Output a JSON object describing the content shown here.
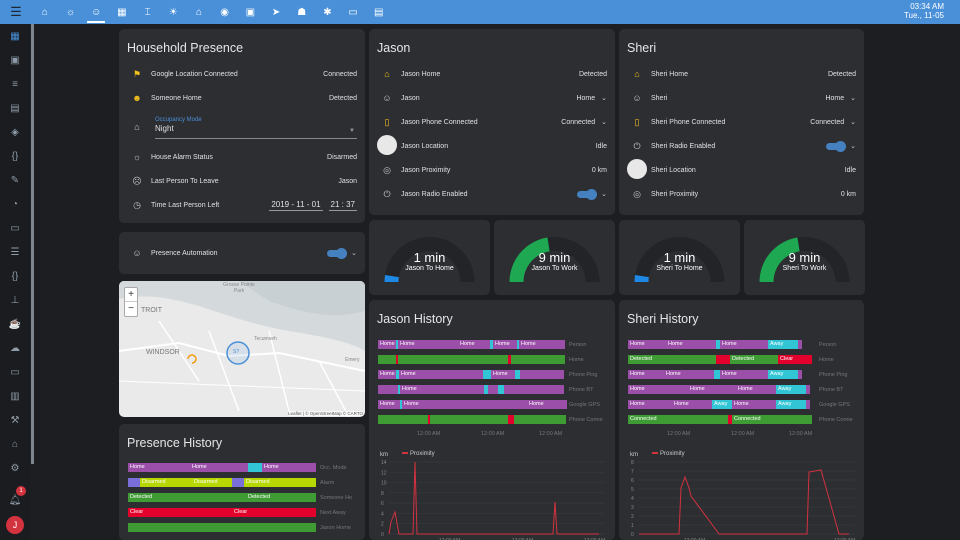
{
  "topbar": {
    "menu_icon": "menu-icon",
    "tabs": [
      {
        "icon": "home-icon",
        "active": false
      },
      {
        "icon": "lightbulb-icon",
        "active": false
      },
      {
        "icon": "people-icon",
        "active": true
      },
      {
        "icon": "calendar-icon",
        "active": false
      },
      {
        "icon": "thermometer-icon",
        "active": false
      },
      {
        "icon": "sun-icon",
        "active": false
      },
      {
        "icon": "garage-icon",
        "active": false
      },
      {
        "icon": "camera-icon",
        "active": false
      },
      {
        "icon": "gallery-icon",
        "active": false
      },
      {
        "icon": "send-icon",
        "active": false
      },
      {
        "icon": "robot-icon",
        "active": false
      },
      {
        "icon": "bug-icon",
        "active": false
      },
      {
        "icon": "monitor-icon",
        "active": false
      },
      {
        "icon": "server-icon",
        "active": false
      }
    ],
    "time": "03:34 AM",
    "date": "Tue., 11-05"
  },
  "sidebar": {
    "notification_count": "1",
    "avatar_letter": "J"
  },
  "household": {
    "title": "Household Presence",
    "rows": [
      {
        "label": "Google Location Connected",
        "value": "Connected"
      },
      {
        "label": "Someone Home",
        "value": "Detected"
      }
    ],
    "occupancy_label": "Occupancy Mode",
    "occupancy_value": "Night",
    "rows2": [
      {
        "label": "House Alarm Status",
        "value": "Disarmed"
      },
      {
        "label": "Last Person To Leave",
        "value": "Jason"
      }
    ],
    "time_left_label": "Time Last Person Left",
    "time_left_date": "2019 - 11 - 01",
    "time_left_time": "21 : 37"
  },
  "automation": {
    "label": "Presence Automation"
  },
  "map": {
    "zoom_in": "+",
    "zoom_out": "−",
    "labels": {
      "detroit": "TROIT",
      "windsor": "WINDSOR",
      "tecumseh": "Tecumseh",
      "emery": "Emery",
      "grosse": "Grosse Pointe Park"
    },
    "attribution": "Leaflet | © OpenStreetMap © CARTO",
    "marker": "S?"
  },
  "jason": {
    "title": "Jason",
    "rows": [
      {
        "label": "Jason Home",
        "value": "Detected"
      },
      {
        "label": "Jason",
        "value": "Home"
      },
      {
        "label": "Jason Phone Connected",
        "value": "Connected"
      },
      {
        "label": "Jason Location",
        "value": "Idle"
      },
      {
        "label": "Jason Proximity",
        "value": "0 km"
      },
      {
        "label": "Jason Radio Enabled",
        "value": ""
      }
    ]
  },
  "sheri": {
    "title": "Sheri",
    "rows": [
      {
        "label": "Sheri Home",
        "value": "Detected"
      },
      {
        "label": "Sheri",
        "value": "Home"
      },
      {
        "label": "Sheri Phone Connected",
        "value": "Connected"
      },
      {
        "label": "Sheri Radio Enabled",
        "value": ""
      },
      {
        "label": "Sheri Location",
        "value": "Idle"
      },
      {
        "label": "Sheri Proximity",
        "value": "0 km"
      }
    ]
  },
  "gauges": [
    {
      "value": "1 min",
      "name": "Jason To Home",
      "fraction": 0.05,
      "color": "#1e88e5"
    },
    {
      "value": "9 min",
      "name": "Jason To Work",
      "fraction": 0.45,
      "color": "#1da851"
    },
    {
      "value": "1 min",
      "name": "Sheri To Home",
      "fraction": 0.05,
      "color": "#1e88e5"
    },
    {
      "value": "9 min",
      "name": "Sheri To Work",
      "fraction": 0.45,
      "color": "#1da851"
    }
  ],
  "jason_history": {
    "title": "Jason History",
    "rows": [
      {
        "name": "Person",
        "segments": [
          {
            "label": "Home",
            "c": "#9b4fa8",
            "w": 18
          },
          {
            "label": "",
            "c": "#31c5d6",
            "w": 2
          },
          {
            "label": "Home",
            "c": "#9b4fa8",
            "w": 60
          },
          {
            "label": "Home",
            "c": "#9b4fa8",
            "w": 32
          },
          {
            "label": "",
            "c": "#31c5d6",
            "w": 3
          },
          {
            "label": "Home",
            "c": "#9b4fa8",
            "w": 24
          },
          {
            "label": "",
            "c": "#31c5d6",
            "w": 1
          },
          {
            "label": "Home",
            "c": "#9b4fa8",
            "w": 46
          }
        ]
      },
      {
        "name": "Home",
        "segments": [
          {
            "label": "",
            "c": "#3f9c35",
            "w": 18
          },
          {
            "label": "",
            "c": "#e3002d",
            "w": 2
          },
          {
            "label": "",
            "c": "#3f9c35",
            "w": 110
          },
          {
            "label": "",
            "c": "#e3002d",
            "w": 3
          },
          {
            "label": "",
            "c": "#3f9c35",
            "w": 54
          }
        ]
      },
      {
        "name": "Phone Ping",
        "segments": [
          {
            "label": "Home",
            "c": "#9b4fa8",
            "w": 18
          },
          {
            "label": "",
            "c": "#31c5d6",
            "w": 3
          },
          {
            "label": "Home",
            "c": "#9b4fa8",
            "w": 84
          },
          {
            "label": "",
            "c": "#31c5d6",
            "w": 8
          },
          {
            "label": "Home",
            "c": "#9b4fa8",
            "w": 24
          },
          {
            "label": "",
            "c": "#31c5d6",
            "w": 5
          },
          {
            "label": "",
            "c": "#9b4fa8",
            "w": 44
          }
        ]
      },
      {
        "name": "Phone BT",
        "segments": [
          {
            "label": "",
            "c": "#9b4fa8",
            "w": 20
          },
          {
            "label": "",
            "c": "#31c5d6",
            "w": 2
          },
          {
            "label": "Home",
            "c": "#9b4fa8",
            "w": 84
          },
          {
            "label": "",
            "c": "#31c5d6",
            "w": 4
          },
          {
            "label": "",
            "c": "#9b4fa8",
            "w": 10
          },
          {
            "label": "",
            "c": "#31c5d6",
            "w": 6
          },
          {
            "label": "",
            "c": "#9b4fa8",
            "w": 60
          }
        ]
      },
      {
        "name": "Google GPS",
        "segments": [
          {
            "label": "Home",
            "c": "#9b4fa8",
            "w": 22
          },
          {
            "label": "",
            "c": "#31c5d6",
            "w": 1
          },
          {
            "label": "Home",
            "c": "#9b4fa8",
            "w": 125
          },
          {
            "label": "Home",
            "c": "#9b4fa8",
            "w": 40
          }
        ]
      },
      {
        "name": "Phone Conne",
        "segments": [
          {
            "label": "",
            "c": "#3f9c35",
            "w": 50
          },
          {
            "label": "",
            "c": "#e3002d",
            "w": 2
          },
          {
            "label": "",
            "c": "#3f9c35",
            "w": 78
          },
          {
            "label": "",
            "c": "#e3002d",
            "w": 6
          },
          {
            "label": "",
            "c": "#3f9c35",
            "w": 52
          }
        ]
      }
    ],
    "axis": [
      "12:00 AM",
      "12:00 AM",
      "12:00 AM"
    ],
    "chart_unit": "km",
    "chart_legend": "Proximity",
    "chart_yticks": [
      "14",
      "12",
      "10",
      "8",
      "6",
      "4",
      "2",
      "0"
    ],
    "chart_xticks": [
      "12:00 AM",
      "12:00 AM",
      "12:00 AM"
    ]
  },
  "sheri_history": {
    "title": "Sheri History",
    "rows": [
      {
        "name": "Person",
        "segments": [
          {
            "label": "Home",
            "c": "#9b4fa8",
            "w": 38
          },
          {
            "label": "Home",
            "c": "#9b4fa8",
            "w": 50
          },
          {
            "label": "",
            "c": "#31c5d6",
            "w": 4
          },
          {
            "label": "Home",
            "c": "#9b4fa8",
            "w": 48
          },
          {
            "label": "Away",
            "c": "#31c5d6",
            "w": 30
          },
          {
            "label": "",
            "c": "#9b4fa8",
            "w": 4
          }
        ]
      },
      {
        "name": "Home",
        "segments": [
          {
            "label": "Detected",
            "c": "#3f9c35",
            "w": 88
          },
          {
            "label": "",
            "c": "#e3002d",
            "w": 14
          },
          {
            "label": "Detected",
            "c": "#3f9c35",
            "w": 48
          },
          {
            "label": "Clear",
            "c": "#e3002d",
            "w": 34
          }
        ]
      },
      {
        "name": "Phone Ping",
        "segments": [
          {
            "label": "Home",
            "c": "#9b4fa8",
            "w": 36
          },
          {
            "label": "Home",
            "c": "#9b4fa8",
            "w": 50
          },
          {
            "label": "",
            "c": "#31c5d6",
            "w": 6
          },
          {
            "label": "Home",
            "c": "#9b4fa8",
            "w": 48
          },
          {
            "label": "Away",
            "c": "#31c5d6",
            "w": 30
          },
          {
            "label": "",
            "c": "#9b4fa8",
            "w": 4
          }
        ]
      },
      {
        "name": "Phone BT",
        "segments": [
          {
            "label": "Home",
            "c": "#9b4fa8",
            "w": 60
          },
          {
            "label": "Home",
            "c": "#9b4fa8",
            "w": 48
          },
          {
            "label": "Home",
            "c": "#9b4fa8",
            "w": 40
          },
          {
            "label": "Away",
            "c": "#31c5d6",
            "w": 30
          },
          {
            "label": "",
            "c": "#9b4fa8",
            "w": 4
          }
        ]
      },
      {
        "name": "Google GPS",
        "segments": [
          {
            "label": "Home",
            "c": "#9b4fa8",
            "w": 44
          },
          {
            "label": "Home",
            "c": "#9b4fa8",
            "w": 40
          },
          {
            "label": "Away",
            "c": "#31c5d6",
            "w": 20
          },
          {
            "label": "Home",
            "c": "#9b4fa8",
            "w": 44
          },
          {
            "label": "Away",
            "c": "#31c5d6",
            "w": 30
          },
          {
            "label": "",
            "c": "#9b4fa8",
            "w": 4
          }
        ]
      },
      {
        "name": "Phone Conne",
        "segments": [
          {
            "label": "Connected",
            "c": "#3f9c35",
            "w": 100
          },
          {
            "label": "",
            "c": "#e3002d",
            "w": 4
          },
          {
            "label": "Connected",
            "c": "#3f9c35",
            "w": 80
          }
        ]
      }
    ],
    "axis": [
      "12:00 AM",
      "12:00 AM",
      "12:00 AM"
    ],
    "chart_unit": "km",
    "chart_legend": "Proximity",
    "chart_yticks": [
      "8",
      "7",
      "6",
      "5",
      "4",
      "3",
      "2",
      "1",
      "0"
    ],
    "chart_xticks": [
      "12:00 AM",
      "12:00 AM"
    ]
  },
  "presence_history": {
    "title": "Presence History",
    "rows": [
      {
        "name": "Occ. Mode",
        "segments": [
          {
            "label": "Home",
            "c": "#9b4fa8",
            "w": 62
          },
          {
            "label": "Home",
            "c": "#9b4fa8",
            "w": 58
          },
          {
            "label": "",
            "c": "#31c5d6",
            "w": 14
          },
          {
            "label": "Home",
            "c": "#9b4fa8",
            "w": 50
          },
          {
            "label": "",
            "c": "#9b4fa8",
            "w": 4
          }
        ]
      },
      {
        "name": "Alarm",
        "segments": [
          {
            "label": "",
            "c": "#7a6fd8",
            "w": 12
          },
          {
            "label": "Disarmed",
            "c": "#b8d600",
            "w": 52
          },
          {
            "label": "Disarmed",
            "c": "#b8d600",
            "w": 40
          },
          {
            "label": "",
            "c": "#7a6fd8",
            "w": 12
          },
          {
            "label": "Disarmed",
            "c": "#b8d600",
            "w": 72
          }
        ]
      },
      {
        "name": "Someone Ho",
        "segments": [
          {
            "label": "Detected",
            "c": "#3f9c35",
            "w": 118
          },
          {
            "label": "Detected",
            "c": "#3f9c35",
            "w": 70
          }
        ]
      },
      {
        "name": "Next Away",
        "segments": [
          {
            "label": "Clear",
            "c": "#e3002d",
            "w": 104
          },
          {
            "label": "Clear",
            "c": "#e3002d",
            "w": 84
          }
        ]
      },
      {
        "name": "Jason Home",
        "segments": [
          {
            "label": "",
            "c": "#3f9c35",
            "w": 188
          }
        ]
      }
    ]
  }
}
